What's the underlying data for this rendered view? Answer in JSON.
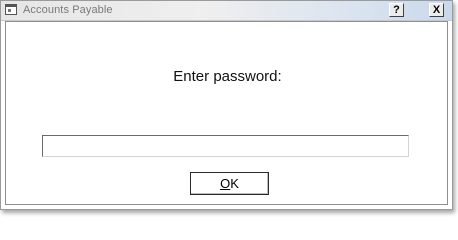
{
  "window": {
    "title": "Accounts Payable",
    "icon": "app-window-icon",
    "help_label": "?",
    "close_label": "X"
  },
  "dialog": {
    "prompt": "Enter password:",
    "password_value": "",
    "ok_mnemonic": "O",
    "ok_rest": "K"
  },
  "colors": {
    "titlebar_text": "#7a7a7a",
    "window_border": "#9a9a9a",
    "background": "#ffffff"
  }
}
